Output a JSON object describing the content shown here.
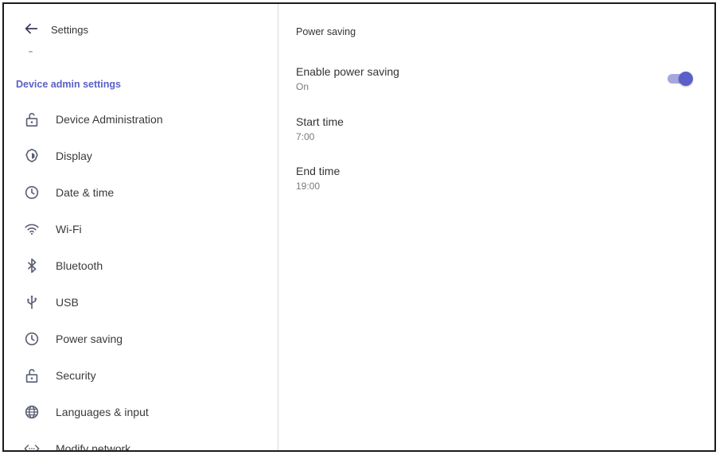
{
  "header": {
    "title": "Settings"
  },
  "sidebar": {
    "section_heading": "Device admin settings",
    "items": [
      {
        "label": "Device Administration",
        "icon": "lock-open-icon"
      },
      {
        "label": "Display",
        "icon": "brightness-icon"
      },
      {
        "label": "Date & time",
        "icon": "clock-icon"
      },
      {
        "label": "Wi-Fi",
        "icon": "wifi-icon"
      },
      {
        "label": "Bluetooth",
        "icon": "bluetooth-icon"
      },
      {
        "label": "USB",
        "icon": "usb-icon"
      },
      {
        "label": "Power saving",
        "icon": "clock-icon"
      },
      {
        "label": "Security",
        "icon": "lock-open-icon"
      },
      {
        "label": "Languages & input",
        "icon": "globe-icon"
      },
      {
        "label": "Modify network",
        "icon": "code-arrows-icon"
      }
    ]
  },
  "detail": {
    "title": "Power saving",
    "enable": {
      "title": "Enable power saving",
      "summary": "On",
      "enabled": true
    },
    "start": {
      "title": "Start time",
      "summary": "7:00"
    },
    "end": {
      "title": "End time",
      "summary": "19:00"
    }
  },
  "colors": {
    "accent": "#5b5fc7",
    "accent_track": "#a5a7dd",
    "icon": "#5b5f75"
  }
}
